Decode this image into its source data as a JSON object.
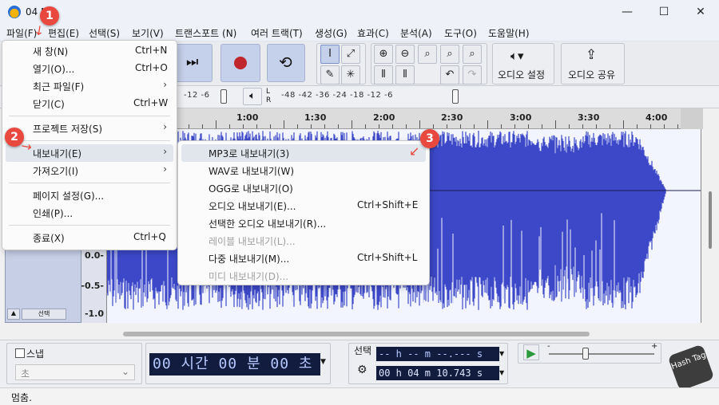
{
  "window": {
    "title": "04 N",
    "minimize": "—",
    "maximize": "☐",
    "close": "✕"
  },
  "menubar": [
    "파일(F)",
    "편집(E)",
    "선택(S)",
    "보기(V)",
    "트랜스포트 (N)",
    "여러 트랙(T)",
    "생성(G)",
    "효과(C)",
    "분석(A)",
    "도구(O)",
    "도움말(H)"
  ],
  "toolbar": {
    "audio_setup": "오디오 설정",
    "share_audio": "오디오 공유"
  },
  "meter": {
    "rec_scale": "-12  -6",
    "play_scale": "-48  -42  -36        -24  -18  -12   -6",
    "lr_left": "L",
    "lr_right": "R"
  },
  "ruler": [
    "1:00",
    "1:30",
    "2:00",
    "2:30",
    "3:00",
    "3:30",
    "4:00"
  ],
  "vscale": [
    "0.0-",
    "-0.5-",
    "-1.0"
  ],
  "track": {
    "select_label": "선택"
  },
  "file_menu": [
    {
      "label": "새 창(N)",
      "shortcut": "Ctrl+N",
      "submenu": false
    },
    {
      "label": "열기(O)...",
      "shortcut": "Ctrl+O",
      "submenu": false
    },
    {
      "label": "최근 파일(F)",
      "shortcut": "",
      "submenu": true
    },
    {
      "label": "닫기(C)",
      "shortcut": "Ctrl+W",
      "submenu": false
    },
    {
      "label": "프로젝트 저장(S)",
      "shortcut": "",
      "submenu": true
    },
    {
      "label": "내보내기(E)",
      "shortcut": "",
      "submenu": true,
      "highlighted": true
    },
    {
      "label": "가져오기(I)",
      "shortcut": "",
      "submenu": true
    },
    {
      "label": "페이지 설정(G)...",
      "shortcut": "",
      "submenu": false
    },
    {
      "label": "인쇄(P)...",
      "shortcut": "",
      "submenu": false
    },
    {
      "label": "종료(X)",
      "shortcut": "Ctrl+Q",
      "submenu": false
    }
  ],
  "export_menu": [
    {
      "label": "MP3로 내보내기(3)",
      "shortcut": "",
      "highlighted": true
    },
    {
      "label": "WAV로 내보내기(W)",
      "shortcut": ""
    },
    {
      "label": "OGG로 내보내기(O)",
      "shortcut": ""
    },
    {
      "label": "오디오 내보내기(E)...",
      "shortcut": "Ctrl+Shift+E"
    },
    {
      "label": "선택한 오디오 내보내기(R)...",
      "shortcut": ""
    },
    {
      "label": "레이블 내보내기(L)...",
      "shortcut": "",
      "disabled": true
    },
    {
      "label": "다중 내보내기(M)...",
      "shortcut": "Ctrl+Shift+L"
    },
    {
      "label": "미디 내보내기(D)...",
      "shortcut": "",
      "disabled": true
    }
  ],
  "badges": [
    "1",
    "2",
    "3"
  ],
  "bottom": {
    "snap_label": "스냅",
    "snap_unit": "초",
    "time_main": "00 시간 00 분 00 초",
    "selection_label": "선택",
    "sel_start": "-- h -- m --.--- s",
    "sel_end": "00 h 04 m 10.743 s",
    "slider_min": "-",
    "slider_max": "+"
  },
  "watermark": "Hash Tag",
  "status": "멈춤.",
  "colors": {
    "waveform": "#3c48c8",
    "waveform_bg": "#f2f5fd",
    "badge": "#e8483e",
    "record": "#c0262c",
    "play": "#2a9a3c"
  }
}
